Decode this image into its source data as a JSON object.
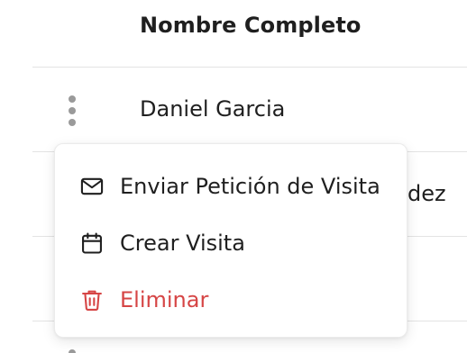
{
  "table": {
    "header": "Nombre Completo",
    "rows": [
      {
        "name": "Daniel Garcia"
      },
      {
        "name_partial": "dez"
      }
    ]
  },
  "context_menu": {
    "items": [
      {
        "label": "Enviar Petición de Visita",
        "icon": "mail-icon"
      },
      {
        "label": "Crear Visita",
        "icon": "calendar-icon"
      },
      {
        "label": "Eliminar",
        "icon": "trash-icon",
        "color": "#d64545"
      }
    ]
  },
  "colors": {
    "text": "#1f1f1f",
    "danger": "#d64545",
    "muted_icon": "#9a9a9a",
    "divider": "#e3e3e3"
  }
}
